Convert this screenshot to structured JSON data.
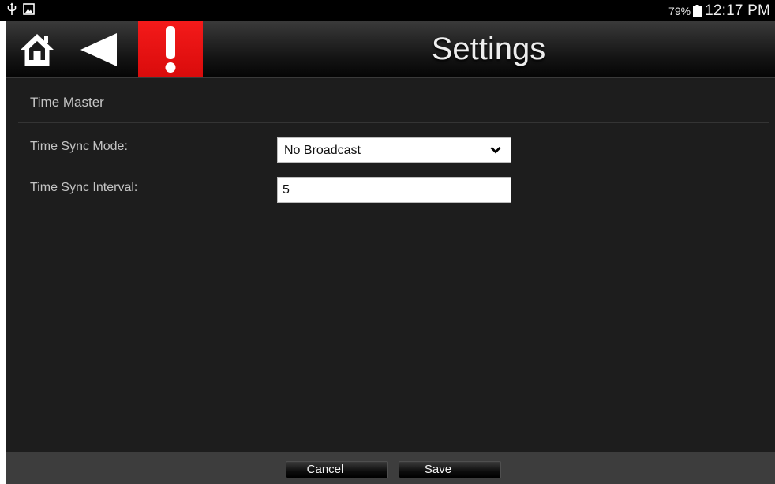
{
  "status_bar": {
    "icons": [
      "usb-icon",
      "image-notification-icon",
      "battery-icon"
    ],
    "battery_percent": "79%",
    "time": "12:17 PM"
  },
  "header": {
    "title": "Settings",
    "icons": [
      "home-icon",
      "back-arrow-icon",
      "alert-exclamation-icon"
    ],
    "alert_color": "#e81010"
  },
  "section": {
    "title": "Time Master"
  },
  "form": {
    "time_sync_mode": {
      "label": "Time Sync Mode:",
      "selected": "No Broadcast"
    },
    "time_sync_interval": {
      "label": "Time Sync Interval:",
      "value": "5"
    }
  },
  "footer": {
    "cancel_label": "Cancel",
    "save_label": "Save"
  }
}
